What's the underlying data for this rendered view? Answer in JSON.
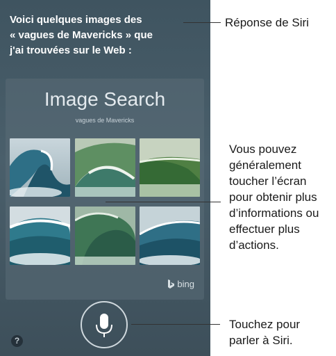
{
  "siri": {
    "response_line1": "Voici quelques images des",
    "response_line2": "« vagues de  Mavericks » que",
    "response_line3": "j'ai trouvées sur le Web :"
  },
  "image_search": {
    "title": "Image Search",
    "query": "vagues de Mavericks",
    "provider": "bing"
  },
  "thumbnails": [
    {
      "name": "wave-image-1"
    },
    {
      "name": "wave-image-2"
    },
    {
      "name": "wave-image-3"
    },
    {
      "name": "wave-image-4"
    },
    {
      "name": "wave-image-5"
    },
    {
      "name": "wave-image-6"
    }
  ],
  "icons": {
    "mic": "microphone-icon",
    "help": "question-icon",
    "help_glyph": "?"
  },
  "callouts": {
    "siri_response": "Réponse de Siri",
    "tap_line1": "Vous pouvez",
    "tap_line2": "généralement",
    "tap_line3": "toucher l’écran",
    "tap_line4": "pour obtenir plus",
    "tap_line5": "d’informations ou",
    "tap_line6": "effectuer plus",
    "tap_line7": "d’actions.",
    "speak_line1": "Touchez pour",
    "speak_line2": "parler à Siri."
  },
  "colors": {
    "background": "#4a5f6b",
    "text": "#ffffff"
  }
}
